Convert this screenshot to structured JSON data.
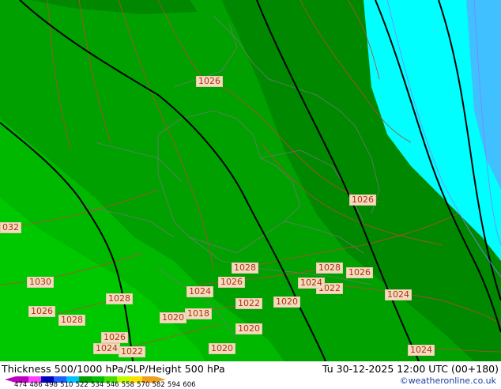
{
  "map": {
    "isobar_labels": [
      {
        "text": "1026",
        "name": "isobar-label-1026-north"
      },
      {
        "text": "1026",
        "name": "isobar-label-1026-east"
      },
      {
        "text": "032",
        "name": "isobar-label-1032-west"
      },
      {
        "text": "1030",
        "name": "isobar-label-1030"
      },
      {
        "text": "1028",
        "name": "isobar-label-1028-center"
      },
      {
        "text": "1028",
        "name": "isobar-label-1028-east"
      },
      {
        "text": "1026",
        "name": "isobar-label-1026-se"
      },
      {
        "text": "1026",
        "name": "isobar-label-1026-center"
      },
      {
        "text": "1024",
        "name": "isobar-label-1024-center"
      },
      {
        "text": "1022",
        "name": "isobar-label-1022-east"
      },
      {
        "text": "1024",
        "name": "isobar-label-1024-mid"
      },
      {
        "text": "1028",
        "name": "isobar-label-1028-west"
      },
      {
        "text": "1026",
        "name": "isobar-label-1026-west"
      },
      {
        "text": "1028",
        "name": "isobar-label-1028-sw"
      },
      {
        "text": "1022",
        "name": "isobar-label-1022-center"
      },
      {
        "text": "1020",
        "name": "isobar-label-1020-east"
      },
      {
        "text": "1020",
        "name": "isobar-label-1020-center"
      },
      {
        "text": "1018",
        "name": "isobar-label-1018"
      },
      {
        "text": "1024",
        "name": "isobar-label-1024-e2"
      },
      {
        "text": "1020",
        "name": "isobar-label-1020-south"
      },
      {
        "text": "1026",
        "name": "isobar-label-1026-south"
      },
      {
        "text": "1024",
        "name": "isobar-label-1024-sw"
      },
      {
        "text": "1022",
        "name": "isobar-label-1022-sw"
      },
      {
        "text": "1020",
        "name": "isobar-label-1020-s2"
      },
      {
        "text": "1024",
        "name": "isobar-label-1024-se2"
      }
    ]
  },
  "footer": {
    "title": "Thickness 500/1000 hPa/SLP/Height 500 hPa",
    "datetime": "Tu 30-12-2025 12:00 UTC (00+180)",
    "credit": "©weatheronline.co.uk",
    "scale_ticks": [
      "474",
      "486",
      "498",
      "510",
      "522",
      "534",
      "546",
      "558",
      "570",
      "582",
      "594",
      "606"
    ],
    "scale_colors": [
      "#c000c0",
      "#ff40ff",
      "#0000c0",
      "#2060ff",
      "#00c0ff",
      "#00a000",
      "#00c000",
      "#40e000",
      "#c0ff00",
      "#ffe000",
      "#f0a020"
    ]
  }
}
